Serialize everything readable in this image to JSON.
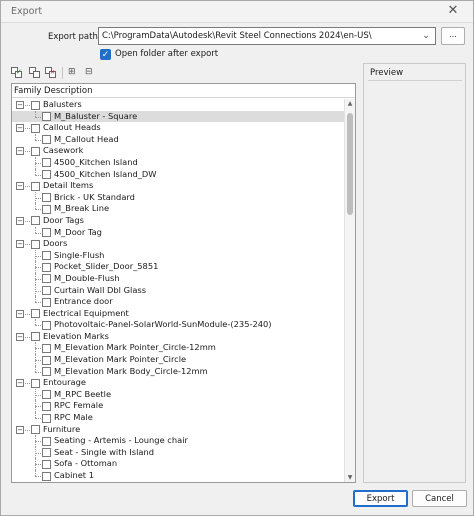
{
  "window": {
    "title": "Export"
  },
  "export_path": {
    "label": "Export path:",
    "value": "C:\\ProgramData\\Autodesk\\Revit Steel Connections 2024\\en-US\\",
    "browse_label": "..."
  },
  "open_folder": {
    "label": "Open folder after export",
    "checked": true
  },
  "toolbar": {
    "icons": [
      "check-all-icon",
      "uncheck-all-icon",
      "invert-selection-icon",
      "expand-all-icon",
      "collapse-all-icon"
    ]
  },
  "tree": {
    "header": "Family Description",
    "groups": [
      {
        "label": "Balusters",
        "items": [
          "M_Baluster - Square"
        ]
      },
      {
        "label": "Callout Heads",
        "items": [
          "M_Callout Head"
        ]
      },
      {
        "label": "Casework",
        "items": [
          "4500_Kitchen Island",
          "4500_Kitchen Island_DW"
        ]
      },
      {
        "label": "Detail Items",
        "items": [
          "Brick - UK Standard",
          "M_Break Line"
        ]
      },
      {
        "label": "Door Tags",
        "items": [
          "M_Door Tag"
        ]
      },
      {
        "label": "Doors",
        "items": [
          "Single-Flush",
          "Pocket_Slider_Door_5851",
          "M_Double-Flush",
          "Curtain Wall Dbl Glass",
          "Entrance door"
        ]
      },
      {
        "label": "Electrical Equipment",
        "items": [
          "Photovoltaic-Panel-SolarWorld-SunModule-(235-240)"
        ]
      },
      {
        "label": "Elevation Marks",
        "items": [
          "M_Elevation Mark Pointer_Circle-12mm",
          "M_Elevation Mark Pointer_Circle",
          "M_Elevation Mark Body_Circle-12mm"
        ]
      },
      {
        "label": "Entourage",
        "items": [
          "M_RPC Beetle",
          "RPC Female",
          "RPC Male"
        ]
      },
      {
        "label": "Furniture",
        "items": [
          "Seating - Artemis - Lounge chair",
          "Seat - Single with Island",
          "Sofa - Ottoman",
          "Cabinet 1"
        ]
      }
    ],
    "selected_item": "M_Baluster - Square"
  },
  "preview": {
    "label": "Preview"
  },
  "buttons": {
    "export": "Export",
    "cancel": "Cancel"
  },
  "colors": {
    "accent": "#1f6ec9",
    "selection": "#dcdcdc"
  }
}
